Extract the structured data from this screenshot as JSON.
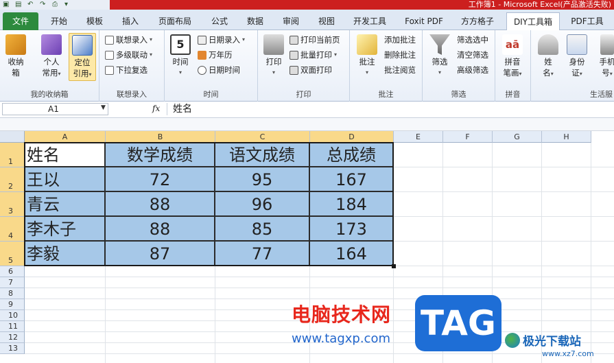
{
  "window": {
    "title": "工作簿1 - Microsoft Excel(产品激活失败)"
  },
  "tabs": [
    {
      "label": "文件",
      "kind": "file"
    },
    {
      "label": "开始"
    },
    {
      "label": "模板"
    },
    {
      "label": "插入"
    },
    {
      "label": "页面布局"
    },
    {
      "label": "公式"
    },
    {
      "label": "数据"
    },
    {
      "label": "审阅"
    },
    {
      "label": "视图"
    },
    {
      "label": "开发工具"
    },
    {
      "label": "Foxit PDF"
    },
    {
      "label": "方方格子"
    },
    {
      "label": "DIY工具箱",
      "active": true
    },
    {
      "label": "PDF工具"
    }
  ],
  "ribbon": {
    "groups": {
      "shoucang": {
        "label": "我的收纳箱",
        "buttons": [
          {
            "label1": "收纳",
            "label2": "箱",
            "icon": "toolbox-icon"
          },
          {
            "label1": "个人",
            "label2": "常用",
            "icon": "personal-icon",
            "dropdown": "▾"
          },
          {
            "label1": "定位",
            "label2": "引用",
            "icon": "locate-icon",
            "dropdown": "▾",
            "selected": true
          }
        ]
      },
      "lianxiang": {
        "label": "联想录入",
        "items": [
          {
            "label": "联想录入",
            "icon": "list-icon",
            "dropdown": "▾"
          },
          {
            "label": "多级联动",
            "icon": "cascade-icon",
            "dropdown": "▾"
          },
          {
            "label": "下拉复选",
            "icon": "checklist-icon"
          }
        ]
      },
      "shijian": {
        "label": "时间",
        "big": {
          "label": "时间",
          "icon": "calendar-icon",
          "dropdown": "▾"
        },
        "items": [
          {
            "label": "日期录入",
            "icon": "date-icon",
            "dropdown": "▾"
          },
          {
            "label": "万年历",
            "icon": "almanac-icon"
          },
          {
            "label": "日期时间",
            "icon": "clock-icon"
          }
        ]
      },
      "dayin": {
        "label": "打印",
        "big": {
          "label": "打印",
          "icon": "printer-icon",
          "dropdown": "▾"
        },
        "items": [
          {
            "label": "打印当前页",
            "icon": "print-page-icon"
          },
          {
            "label": "批量打印",
            "icon": "batch-print-icon",
            "dropdown": "▾"
          },
          {
            "label": "双面打印",
            "icon": "duplex-print-icon"
          }
        ]
      },
      "pizhu": {
        "label": "批注",
        "big": {
          "label": "批注",
          "icon": "comment-icon",
          "dropdown": "▾"
        },
        "items": [
          {
            "label": "添加批注"
          },
          {
            "label": "删除批注"
          },
          {
            "label": "批注阅览"
          }
        ]
      },
      "shaixuan": {
        "label": "筛选",
        "big": {
          "label": "筛选",
          "icon": "filter-icon",
          "dropdown": "▾"
        },
        "items": [
          {
            "label": "筛选选中"
          },
          {
            "label": "清空筛选"
          },
          {
            "label": "高级筛选"
          }
        ]
      },
      "pinyin": {
        "label": "拼音",
        "big": {
          "label1": "拼音",
          "label2": "笔画",
          "icon": "pinyin-icon",
          "dropdown": "▾"
        }
      },
      "shenghuo": {
        "label": "生活服",
        "buttons": [
          {
            "label1": "姓",
            "label2": "名",
            "icon": "person-icon",
            "dropdown": "▾"
          },
          {
            "label1": "身份",
            "label2": "证",
            "icon": "id-card-icon",
            "dropdown": "▾"
          },
          {
            "label1": "手机",
            "label2": "号",
            "icon": "phone-icon",
            "dropdown": "▾"
          }
        ]
      }
    }
  },
  "formula_bar": {
    "name_box": "A1",
    "fx_label": "fx",
    "content": "姓名"
  },
  "sheet": {
    "columns": [
      "A",
      "B",
      "C",
      "D",
      "E",
      "F",
      "G",
      "H"
    ],
    "rows": [
      "1",
      "2",
      "3",
      "4",
      "5",
      "6",
      "7",
      "8",
      "9",
      "10",
      "11",
      "12",
      "13"
    ],
    "header": [
      "姓名",
      "数学成绩",
      "语文成绩",
      "总成绩"
    ],
    "data": [
      [
        "王以",
        "72",
        "95",
        "167"
      ],
      [
        "青云",
        "88",
        "96",
        "184"
      ],
      [
        "李木子",
        "88",
        "85",
        "173"
      ],
      [
        "李毅",
        "87",
        "77",
        "164"
      ]
    ],
    "fill_color": "#a6c8e8",
    "selection_header_color": "#f9d98a"
  },
  "watermark": {
    "site_name": "电脑技术网",
    "url": "www.tagxp.com",
    "tag": "TAG",
    "jg_name": "极光下载站",
    "jg_url": "www.xz7.com"
  }
}
